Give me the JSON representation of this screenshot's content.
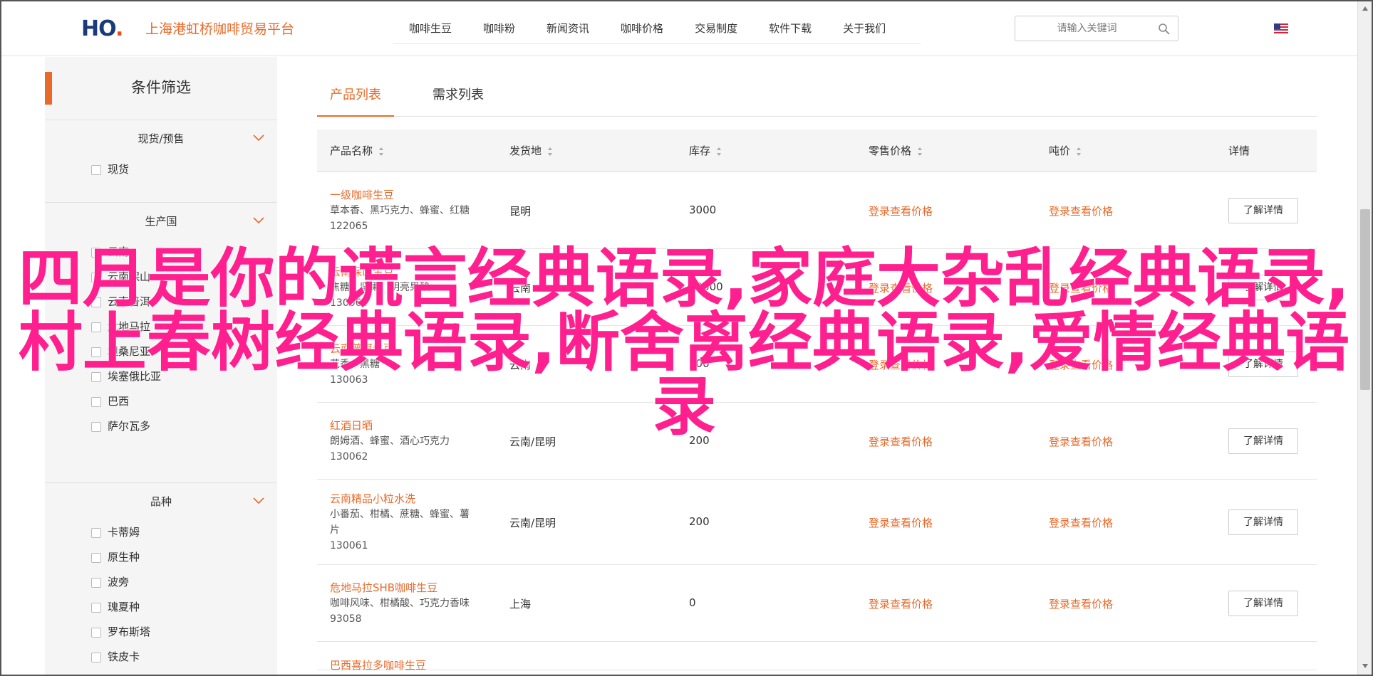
{
  "header": {
    "brand": "上海港虹桥咖啡贸易平台",
    "logo_text": "HO",
    "nav": [
      "咖啡生豆",
      "咖啡粉",
      "新闻资讯",
      "咖啡价格",
      "交易制度",
      "软件下载",
      "关于我们"
    ],
    "search_placeholder": "请输入关键词"
  },
  "sidebar": {
    "title": "条件筛选",
    "groups": [
      {
        "label": "现货/预售",
        "options": [
          "现货"
        ]
      },
      {
        "label": "生产国",
        "options": [
          "云南",
          "云南保山",
          "云南普洱",
          "危地马拉",
          "坦桑尼亚",
          "埃塞俄比亚",
          "巴西",
          "萨尔瓦多"
        ]
      },
      {
        "label": "品种",
        "options": [
          "卡蒂姆",
          "原生种",
          "波旁",
          "瑰夏种",
          "罗布斯塔",
          "铁皮卡"
        ]
      }
    ]
  },
  "tabs": [
    "产品列表",
    "需求列表"
  ],
  "table": {
    "headers": [
      "产品名称",
      "发货地",
      "库存",
      "零售价格",
      "吨价",
      "详情"
    ],
    "login_text": "登录查看价格",
    "detail_label": "了解详情",
    "rows": [
      {
        "name": "一级咖啡生豆",
        "desc": [
          "草本香、黑巧克力、蜂蜜、红糖"
        ],
        "id": "122065",
        "origin": "昆明",
        "stock": "3000"
      },
      {
        "name": "云南保山生豆",
        "desc": [
          "焦糖、坚果、明亮果酸"
        ],
        "id": "130064",
        "origin": "云南",
        "stock": "30000"
      },
      {
        "name": "云南普洱生豆",
        "desc": [
          "花香、黑糖"
        ],
        "id": "130063",
        "origin": "云南",
        "stock": "200"
      },
      {
        "name": "红酒日晒",
        "desc": [
          "朗姆酒、蜂蜜、酒心巧克力"
        ],
        "id": "130062",
        "origin": "云南/昆明",
        "stock": "200"
      },
      {
        "name": "云南精品小粒水洗",
        "desc": [
          "小番茄、柑橘、蔗糖、蜂蜜、薯",
          "片"
        ],
        "id": "130061",
        "origin": "云南/昆明",
        "stock": "200"
      },
      {
        "name": "危地马拉SHB咖啡生豆",
        "desc": [
          "咖啡风味、柑橘酸、巧克力香味"
        ],
        "id": "93058",
        "origin": "上海",
        "stock": "0"
      },
      {
        "name": "巴西喜拉多咖啡生豆",
        "desc": [],
        "id": "",
        "origin": "",
        "stock": ""
      }
    ]
  },
  "overlay_title": "四月是你的谎言经典语录,家庭大杂乱经典语录,村上春树经典语录,断舍离经典语录,爱情经典语录"
}
